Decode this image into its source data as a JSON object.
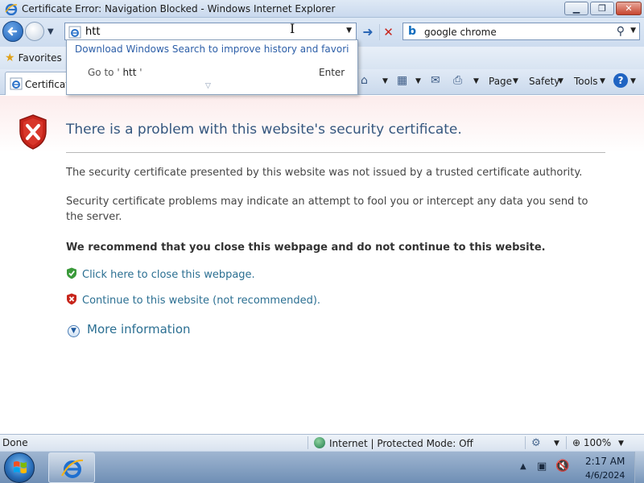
{
  "window": {
    "title": "Certificate Error: Navigation Blocked - Windows Internet Explorer",
    "minimize_glyph": "▁",
    "maximize_glyph": "❐",
    "close_glyph": "✕"
  },
  "nav": {
    "address_value": "htt",
    "search_value": "google chrome",
    "search_provider_icon": "bing-icon"
  },
  "autocomplete": {
    "suggestion": "Download Windows Search to improve history and favorites r...",
    "goto_prefix": "Go to ' ",
    "goto_value": "htt",
    "goto_suffix": " '",
    "enter_label": "Enter"
  },
  "favorites_bar": {
    "favorites_label": "Favorites"
  },
  "tab": {
    "label": "Certificate Error: Navigation Blocked"
  },
  "command_bar": {
    "page_label": "Page",
    "safety_label": "Safety",
    "tools_label": "Tools"
  },
  "content": {
    "headline": "There is a problem with this website's security certificate.",
    "paragraph1": "The security certificate presented by this website was not issued by a trusted certificate authority.",
    "paragraph2": "Security certificate problems may indicate an attempt to fool you or intercept any data you send to the server.",
    "recommendation": "We recommend that you close this webpage and do not continue to this website.",
    "close_link": "Click here to close this webpage.",
    "continue_link": "Continue to this website (not recommended).",
    "more_info": "More information"
  },
  "status_bar": {
    "status": "Done",
    "zone": "Internet | Protected Mode: Off",
    "zoom": "100%"
  },
  "taskbar": {
    "time": "2:17 AM",
    "date": "4/6/2024"
  },
  "colors": {
    "link": "#2b6f92",
    "headline": "#35577f",
    "error_red": "#c7251b",
    "safe_green": "#3a9a3a"
  }
}
